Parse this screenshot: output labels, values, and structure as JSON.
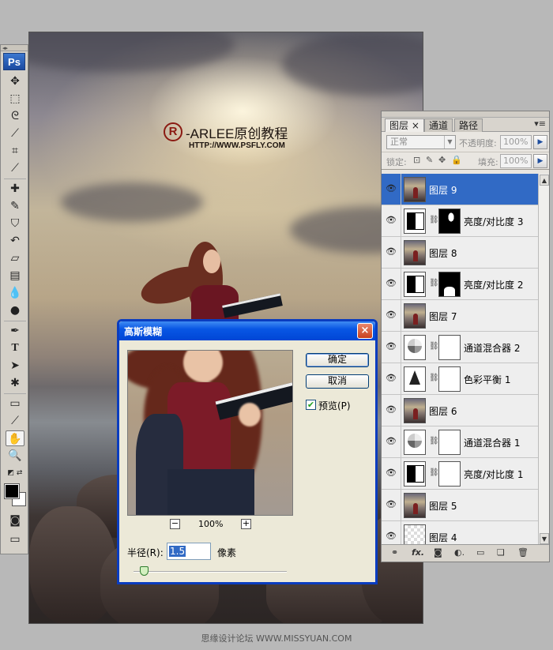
{
  "watermark": {
    "logo": "R",
    "title": "-ARLEE原创教程",
    "url": "HTTP://WWW.PSFLY.COM"
  },
  "tools_panel": {
    "logo": "Ps",
    "grip": "◂▸"
  },
  "layers_panel": {
    "tabs": [
      {
        "label": "图层 ×",
        "selected": true
      },
      {
        "label": "通道",
        "selected": false
      },
      {
        "label": "路径",
        "selected": false
      }
    ],
    "menu_icon": "▾≡",
    "blend_mode": "正常",
    "opacity_label": "不透明度:",
    "opacity_value": "100%",
    "lock_label": "锁定:",
    "fill_label": "填充:",
    "fill_value": "100%",
    "layers": [
      {
        "name": "图层 9",
        "thumb": "photo",
        "mask": "",
        "selected": true
      },
      {
        "name": "亮度/对比度 3",
        "thumb": "adj",
        "mask": "dark",
        "selected": false
      },
      {
        "name": "图层 8",
        "thumb": "photo",
        "mask": "",
        "selected": false
      },
      {
        "name": "亮度/对比度 2",
        "thumb": "adj",
        "mask": "dark2",
        "selected": false
      },
      {
        "name": "图层 7",
        "thumb": "photo",
        "mask": "",
        "selected": false
      },
      {
        "name": "通道混合器 2",
        "thumb": "mixer",
        "mask": "white",
        "selected": false
      },
      {
        "name": "色彩平衡 1",
        "thumb": "balance",
        "mask": "white",
        "selected": false
      },
      {
        "name": "图层 6",
        "thumb": "photo",
        "mask": "",
        "selected": false
      },
      {
        "name": "通道混合器 1",
        "thumb": "mixer",
        "mask": "white",
        "selected": false
      },
      {
        "name": "亮度/对比度 1",
        "thumb": "adj",
        "mask": "white",
        "selected": false
      },
      {
        "name": "图层 5",
        "thumb": "photo",
        "mask": "",
        "selected": false
      },
      {
        "name": "图层 4",
        "thumb": "empty",
        "mask": "",
        "selected": false
      }
    ]
  },
  "dialog": {
    "title": "高斯模糊",
    "close_glyph": "×",
    "ok_label": "确定",
    "cancel_label": "取消",
    "preview_label": "预览(P)",
    "preview_checked": true,
    "zoom_out_glyph": "−",
    "zoom_in_glyph": "+",
    "zoom_level": "100%",
    "radius_label": "半径(R):",
    "radius_value": "1.5",
    "radius_unit": "像素"
  },
  "footer": {
    "text": "思缘设计论坛 WWW.MISSYUAN.COM"
  },
  "colors": {
    "selection_blue": "#316ac5",
    "dialog_title_blue": "#0856e4",
    "panel_bg": "#e9e6e1",
    "desktop_gray": "#b8b8b8"
  }
}
